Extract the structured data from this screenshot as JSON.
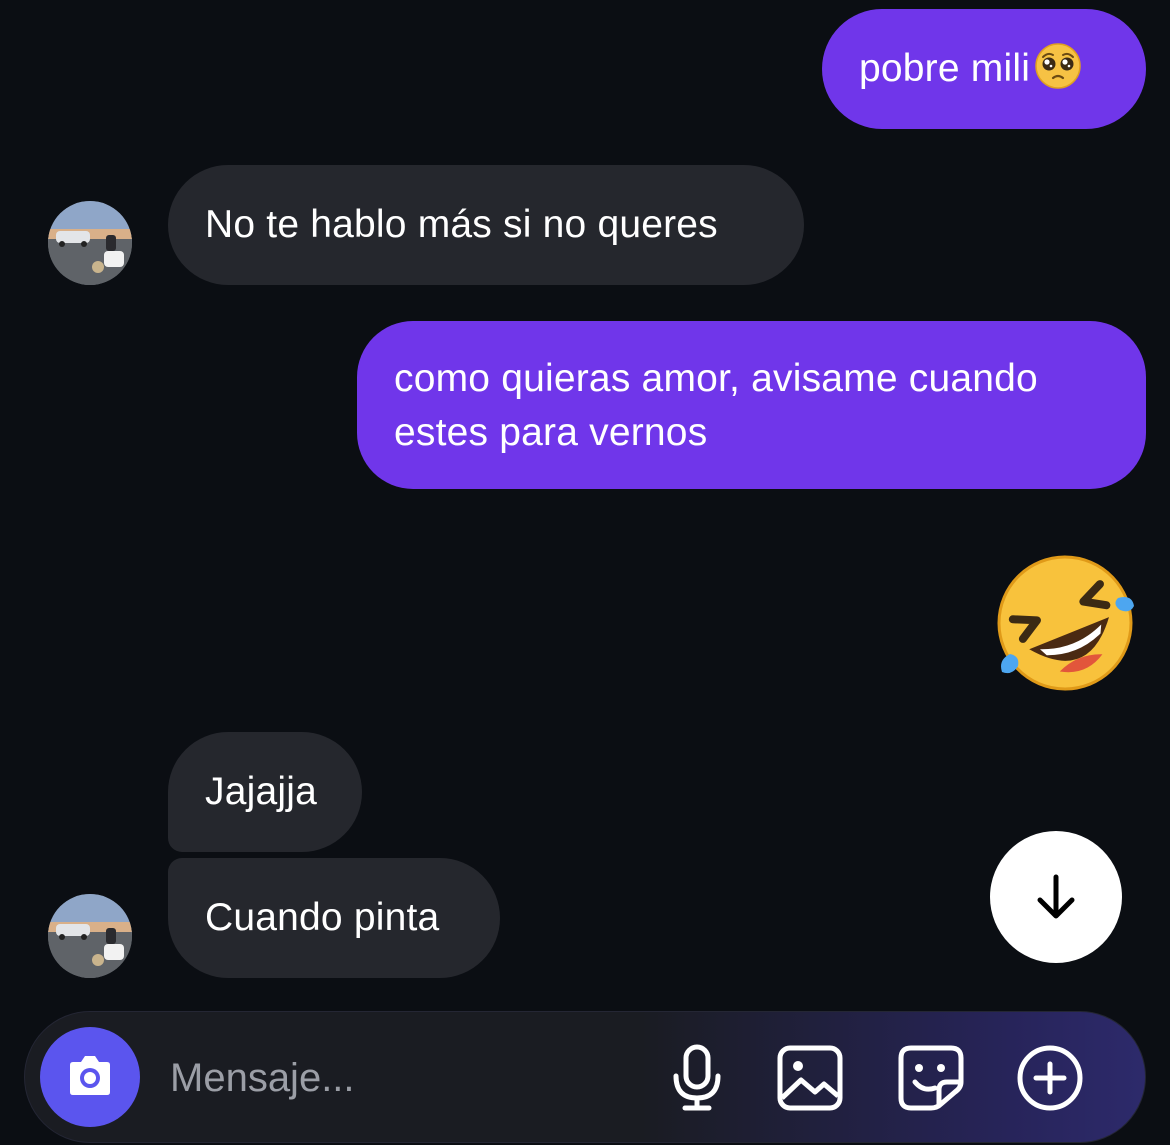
{
  "messages": [
    {
      "id": "m1",
      "direction": "outgoing",
      "text": "pobre mili",
      "emoji": "pleading-face"
    },
    {
      "id": "m2",
      "direction": "incoming",
      "text": "No te hablo más si no queres"
    },
    {
      "id": "m3",
      "direction": "outgoing",
      "lines": [
        "como quieras amor, avisame cuando",
        "estes para vernos"
      ]
    },
    {
      "id": "m4",
      "direction": "outgoing",
      "emoji": "rolling-on-the-floor-laughing"
    },
    {
      "id": "m5",
      "direction": "incoming",
      "text": "Jajajja"
    },
    {
      "id": "m6",
      "direction": "incoming",
      "text": "Cuando pinta"
    }
  ],
  "composer": {
    "placeholder": "Mensaje...",
    "icons": [
      "camera-icon",
      "microphone-icon",
      "gallery-icon",
      "sticker-icon",
      "plus-icon"
    ]
  },
  "scroll_button_icon": "arrow-down-icon",
  "colors": {
    "background": "#0b0e13",
    "outgoing_bubble": "#7036ea",
    "incoming_bubble": "#25272d",
    "camera_button": "#5b55ee"
  }
}
